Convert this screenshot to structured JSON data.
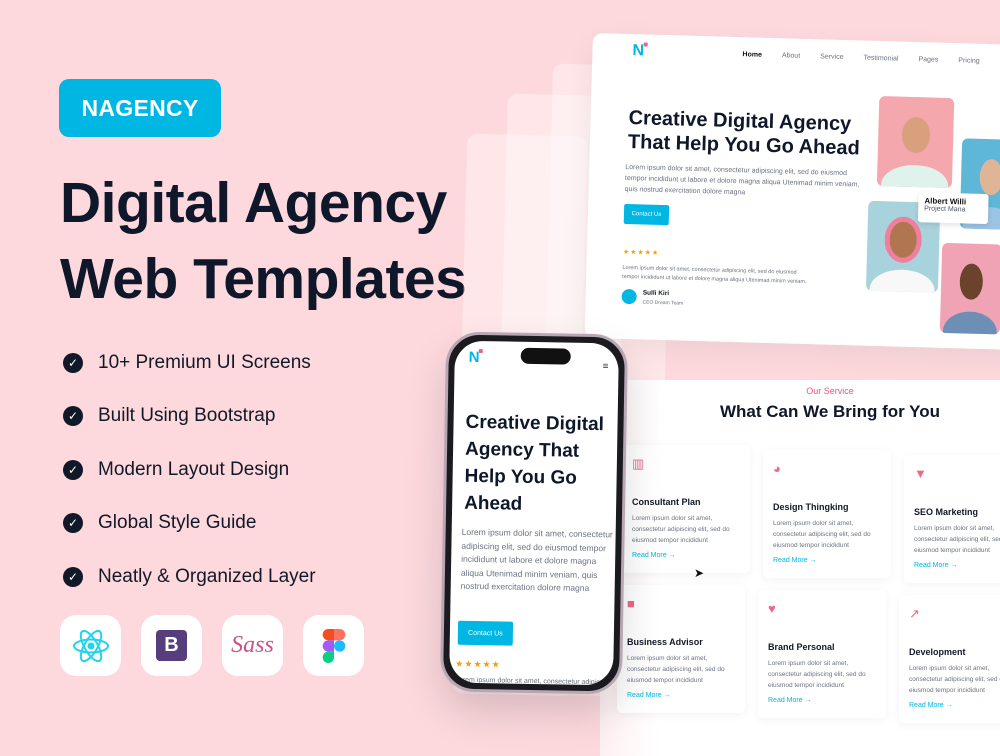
{
  "hero": {
    "badge": "NAGENCY",
    "title_line1": "Digital Agency",
    "title_line2": "Web Templates",
    "features": [
      "10+ Premium UI Screens",
      "Built Using Bootstrap",
      "Modern Layout Design",
      "Global Style Guide",
      "Neatly & Organized Layer"
    ],
    "tools": [
      {
        "icon": "react-icon"
      },
      {
        "icon": "bootstrap-icon",
        "label": "B"
      },
      {
        "icon": "sass-icon",
        "label": "Sass"
      },
      {
        "icon": "figma-icon"
      }
    ]
  },
  "website": {
    "logo": "N",
    "nav": [
      "Home",
      "About",
      "Service",
      "Testimonial",
      "Pages",
      "Pricing"
    ],
    "title_line1": "Creative Digital Agency",
    "title_line2": "That Help You Go Ahead",
    "description": "Lorem ipsum dolor sit amet, consectetur adipiscing elit, sed do eiusmod tempor incididunt ut labore et dolore magna aliqua Utenimad minim veniam, quis nostrud exercitation dolore magna",
    "cta": "Contact Us",
    "stars": "★★★★★",
    "testimonial": "Lorem ipsum dolor sit amet, consectetur adipiscing elit, sed do eiusmod tempor incididunt ut labore et dolore magna aliqua Utenimad minim veniam.",
    "author_name": "Sulli Kiri",
    "author_role": "CEO Dream Team",
    "team_card_name": "Albert Willi",
    "team_card_role": "Project Mana",
    "colors": {
      "accent": "#00b6e3",
      "pink": "#ec6a86",
      "background": "#fdd9de"
    }
  },
  "services": {
    "eyebrow": "Our Service",
    "title": "What Can We Bring for You",
    "cards": [
      {
        "icon": "chart-icon",
        "title": "Consultant Plan",
        "desc": "Lorem ipsum dolor sit amet, consectetur adipiscing elit, sed do eiusmod tempor incididunt",
        "link": "Read More"
      },
      {
        "icon": "pie-chart-icon",
        "title": "Design Thingking",
        "desc": "Lorem ipsum dolor sit amet, consectetur adipiscing elit, sed do eiusmod tempor incididunt",
        "link": "Read More"
      },
      {
        "icon": "funnel-icon",
        "title": "SEO Marketing",
        "desc": "Lorem ipsum dolor sit amet, consectetur adipiscing elit, sed do eiusmod tempor incididunt",
        "link": "Read More"
      },
      {
        "icon": "briefcase-icon",
        "title": "Business Advisor",
        "desc": "Lorem ipsum dolor sit amet, consectetur adipiscing elit, sed do eiusmod tempor incididunt",
        "link": "Read More"
      },
      {
        "icon": "heart-icon",
        "title": "Brand Personal",
        "desc": "Lorem ipsum dolor sit amet, consectetur adipiscing elit, sed do eiusmod tempor incididunt",
        "link": "Read More"
      },
      {
        "icon": "trend-icon",
        "title": "Development",
        "desc": "Lorem ipsum dolor sit amet, consectetur adipiscing elit, sed do eiusmod tempor incididunt",
        "link": "Read More"
      }
    ]
  },
  "phone": {
    "logo": "N",
    "title": "Creative Digital Agency That Help You Go Ahead",
    "description": "Lorem ipsum dolor sit amet, consectetur adipiscing elit, sed do eiusmod tempor incididunt ut labore et dolore magna aliqua Utenimad minim veniam, quis nostrud exercitation dolore magna",
    "cta": "Contact Us",
    "stars": "★★★★★",
    "snippet": "Lorem ipsum dolor sit amet, consectetur adipiscing"
  }
}
